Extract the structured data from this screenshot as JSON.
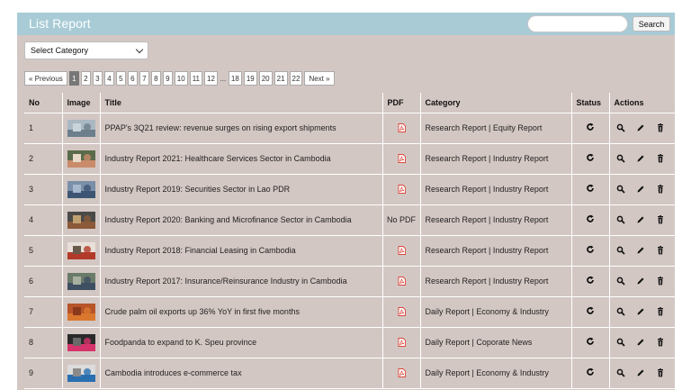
{
  "header": {
    "title": "List Report",
    "search_placeholder": "",
    "search_button": "Search"
  },
  "filter": {
    "category_selected": "Select Category"
  },
  "pagination": {
    "previous": "« Previous",
    "pages": [
      "1",
      "2",
      "3",
      "4",
      "5",
      "6",
      "7",
      "8",
      "9",
      "10",
      "11",
      "12",
      "...",
      "18",
      "19",
      "20",
      "21",
      "22"
    ],
    "active": "1",
    "next": "Next »"
  },
  "table": {
    "columns": [
      "No",
      "Image",
      "Title",
      "PDF",
      "Category",
      "Status",
      "Actions"
    ],
    "rows": [
      {
        "no": "1",
        "title": "PPAP's 3Q21 review: revenue surges on rising export shipments",
        "pdf": "icon",
        "category": "Research Report | Equity Report",
        "thumb": "port"
      },
      {
        "no": "2",
        "title": "Industry Report 2021: Healthcare Services Sector in Cambodia",
        "pdf": "icon",
        "category": "Research Report | Industry Report",
        "thumb": "health"
      },
      {
        "no": "3",
        "title": "Industry Report 2019: Securities Sector in Lao PDR",
        "pdf": "icon",
        "category": "Research Report | Industry Report",
        "thumb": "city"
      },
      {
        "no": "4",
        "title": "Industry Report 2020: Banking and Microfinance Sector in Cambodia",
        "pdf": "No PDF",
        "category": "Research Report | Industry Report",
        "thumb": "bank"
      },
      {
        "no": "5",
        "title": "Industry Report 2018: Financial Leasing in Cambodia",
        "pdf": "icon",
        "category": "Research Report | Industry Report",
        "thumb": "leasing"
      },
      {
        "no": "6",
        "title": "Industry Report 2017: Insurance/Reinsurance Industry in Cambodia",
        "pdf": "icon",
        "category": "Research Report | Industry Report",
        "thumb": "insurance"
      },
      {
        "no": "7",
        "title": "Crude palm oil exports up 36% YoY in first five months",
        "pdf": "icon",
        "category": "Daily Report | Economy & Industry",
        "thumb": "palm"
      },
      {
        "no": "8",
        "title": "Foodpanda to expand to K. Speu province",
        "pdf": "icon",
        "category": "Daily Report | Coporate News",
        "thumb": "foodpanda"
      },
      {
        "no": "9",
        "title": "Cambodia introduces e-commerce tax",
        "pdf": "icon",
        "category": "Daily Report | Economy & Industry",
        "thumb": "ecommerce"
      }
    ]
  },
  "icons": {
    "status": "refresh-icon",
    "view": "search-icon",
    "edit": "pencil-icon",
    "delete": "trash-icon",
    "pdf": "pdf-file-icon"
  },
  "colors": {
    "header_bg": "#a8cbd6",
    "panel_bg": "#d3c7c3",
    "pdf_red": "#d9463a"
  }
}
